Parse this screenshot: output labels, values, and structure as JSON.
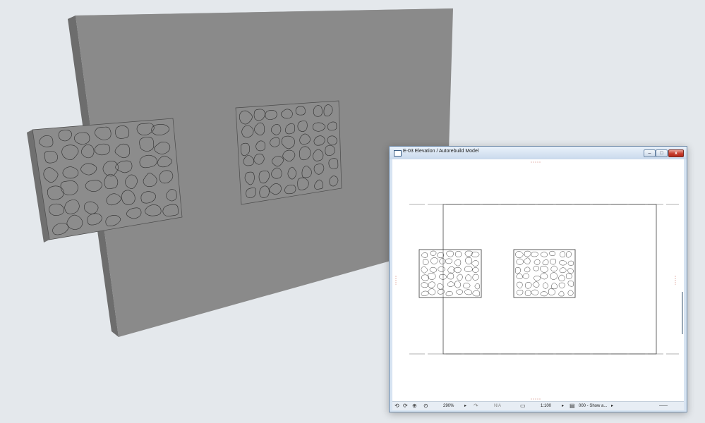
{
  "window": {
    "title": "E-03 Elevation / Autorebuild Model",
    "minimize_glyph": "–",
    "maximize_glyph": "□",
    "close_glyph": "x"
  },
  "statusbar": {
    "undo_icon": "undo-icon",
    "redo_icon": "redo-icon",
    "zoom_in_icon": "zoom-in-icon",
    "zoom_fit_icon": "zoom-fit-icon",
    "zoom": "290%",
    "angle": "N/A",
    "scale": "1:100",
    "layer_combo": "000 - Show a...",
    "arrow": "▸"
  },
  "colors": {
    "wall_front": "#8a8a8a",
    "wall_edge": "#6d6d6d",
    "background": "#e4e8ec",
    "panel_fill": "#8c8c8c"
  }
}
